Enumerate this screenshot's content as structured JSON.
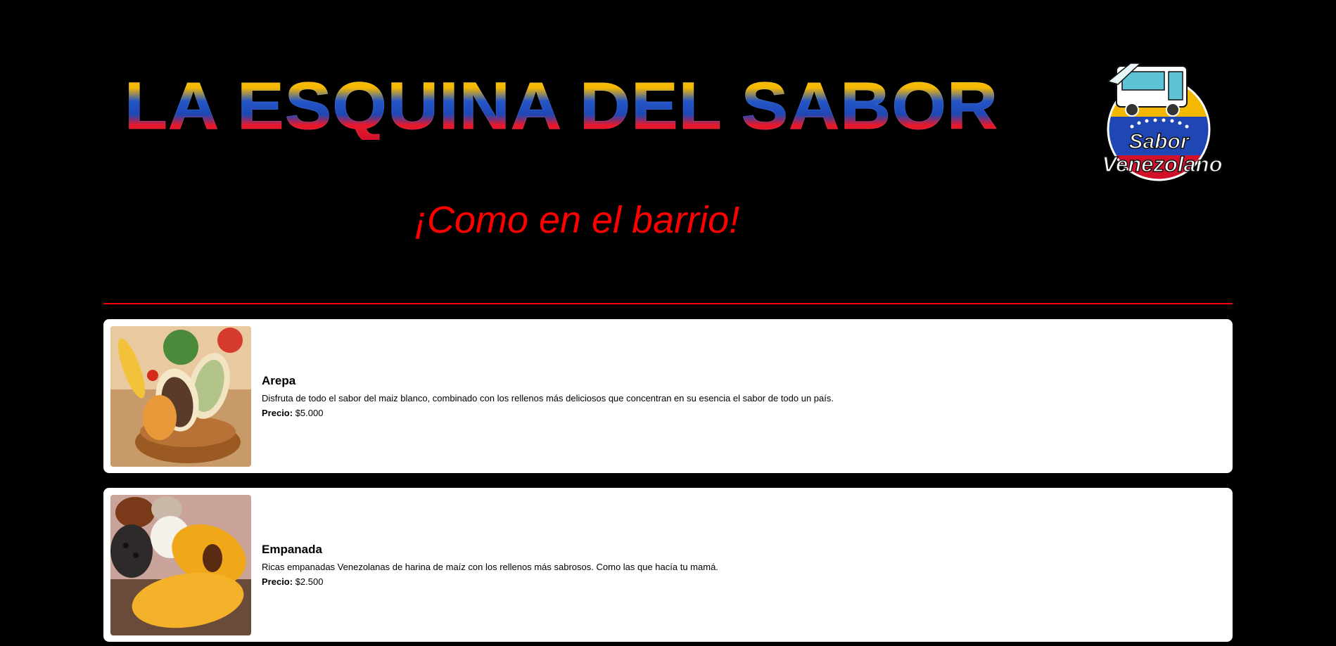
{
  "header": {
    "title": "LA ESQUINA DEL SABOR",
    "tagline": "¡Como en el barrio!",
    "logo_text_line1": "Sabor",
    "logo_text_line2": "Venezolano"
  },
  "colors": {
    "background": "#000000",
    "accent": "#ff0000",
    "flag_yellow": "#f5b800",
    "flag_blue": "#1e47b5",
    "flag_red": "#d2102a",
    "card_background": "#ffffff"
  },
  "menu": {
    "items": [
      {
        "name": "Arepa",
        "description": "Disfruta de todo el sabor del maiz blanco, combinado con los rellenos más deliciosos que concentran en su esencia el sabor de todo un país.",
        "price_label": "Precio:",
        "price": "$5.000",
        "image_icon": "arepa-photo"
      },
      {
        "name": "Empanada",
        "description": "Ricas empanadas Venezolanas de harina de maíz con los rellenos más sabrosos. Como las que hacía tu mamá.",
        "price_label": "Precio:",
        "price": "$2.500",
        "image_icon": "empanada-photo"
      }
    ]
  }
}
